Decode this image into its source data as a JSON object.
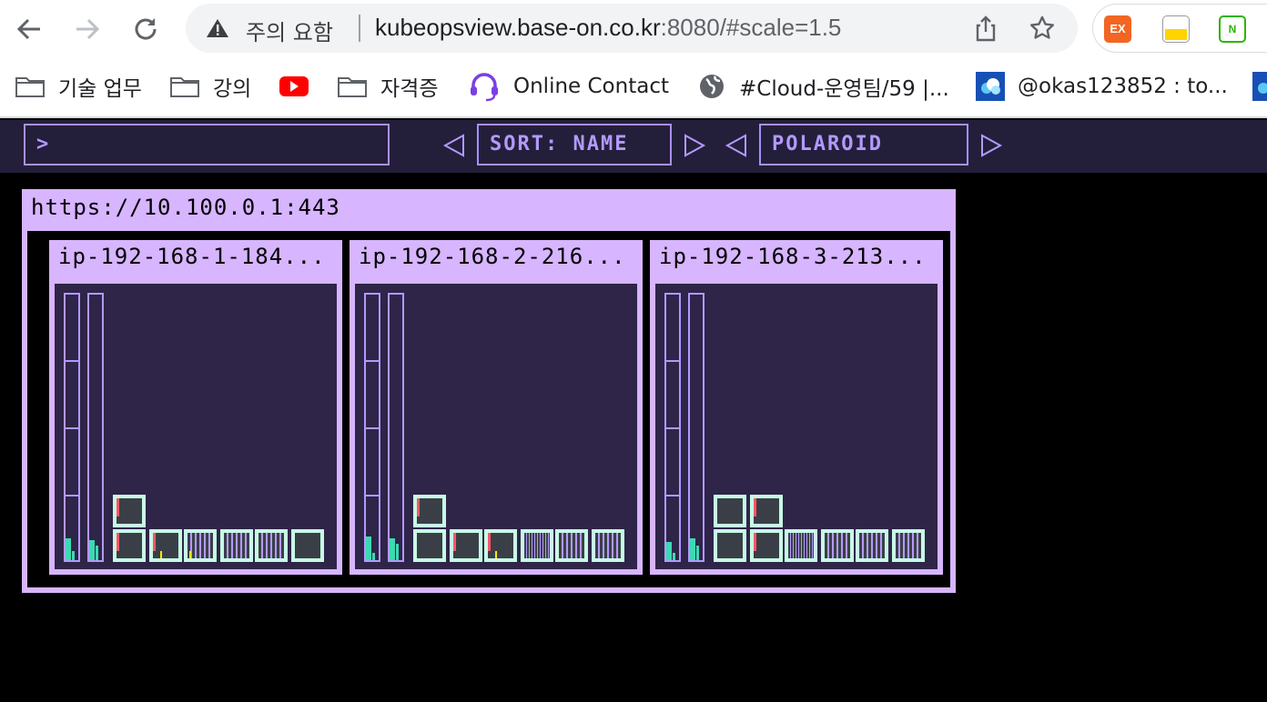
{
  "browser": {
    "warning_text": "주의 요함",
    "url_host": "kubeopsview.base-on.co.kr",
    "url_rest": ":8080/#scale=1.5",
    "extensions": [
      "EX",
      "",
      "N"
    ]
  },
  "bookmarks": [
    {
      "label": "기술 업무",
      "icon": "folder-icon"
    },
    {
      "label": "강의",
      "icon": "folder-icon"
    },
    {
      "label": "",
      "icon": "youtube-icon"
    },
    {
      "label": "자격증",
      "icon": "folder-icon"
    },
    {
      "label": "Online Contact",
      "icon": "headset-icon"
    },
    {
      "label": "#Cloud-운영팀/59 |...",
      "icon": "globe-icon"
    },
    {
      "label": "@okas123852 : to...",
      "icon": "cloud-icon"
    }
  ],
  "app": {
    "filter_value": ">",
    "sort_label": "SORT: NAME",
    "theme_label": "POLAROID",
    "cluster": {
      "url": "https://10.100.0.1:443",
      "nodes": [
        {
          "name": "ip-192-168-1-184..."
        },
        {
          "name": "ip-192-168-2-216..."
        },
        {
          "name": "ip-192-168-3-213..."
        }
      ]
    }
  }
}
